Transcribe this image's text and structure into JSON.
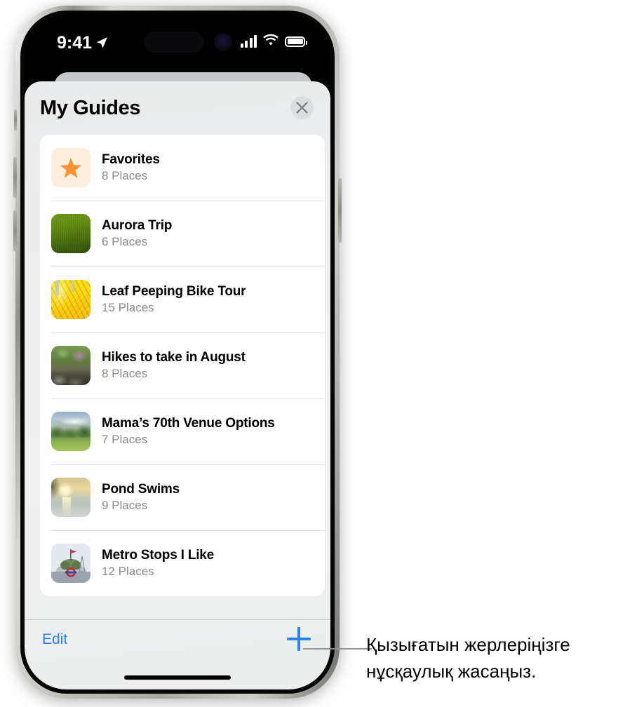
{
  "status_bar": {
    "time": "9:41",
    "location_icon": "location-arrow-icon",
    "cellular_icon": "cellular-signal-icon",
    "wifi_icon": "wifi-icon",
    "battery_icon": "battery-icon"
  },
  "sheet": {
    "title": "My Guides",
    "close_icon": "close-icon"
  },
  "guides": [
    {
      "title": "Favorites",
      "places": "8 Places",
      "thumb": "star-icon-thumbnail"
    },
    {
      "title": "Aurora Trip",
      "places": "6 Places",
      "thumb": "green-field-photo"
    },
    {
      "title": "Leaf Peeping Bike Tour",
      "places": "15 Places",
      "thumb": "yellow-autumn-leaves-photo"
    },
    {
      "title": "Hikes to take in August",
      "places": "8 Places",
      "thumb": "forest-trail-photo"
    },
    {
      "title": "Mama’s 70th Venue Options",
      "places": "7 Places",
      "thumb": "meadow-and-trees-photo"
    },
    {
      "title": "Pond Swims",
      "places": "9 Places",
      "thumb": "sunset-over-lake-photo"
    },
    {
      "title": "Metro Stops I Like",
      "places": "12 Places",
      "thumb": "metro-station-landmark-photo"
    }
  ],
  "toolbar": {
    "edit_label": "Edit",
    "add_icon": "plus-icon"
  },
  "callout": {
    "text": "Қызығатын жерлеріңізге нұсқаулық жасаңыз."
  },
  "colors": {
    "accent_blue": "#2b80f2",
    "star_orange": "#f79131",
    "sheet_bg": "#eceeef",
    "card_bg": "#ffffff",
    "secondary_text": "#888a8c",
    "leader_line": "#8e8e8e"
  }
}
